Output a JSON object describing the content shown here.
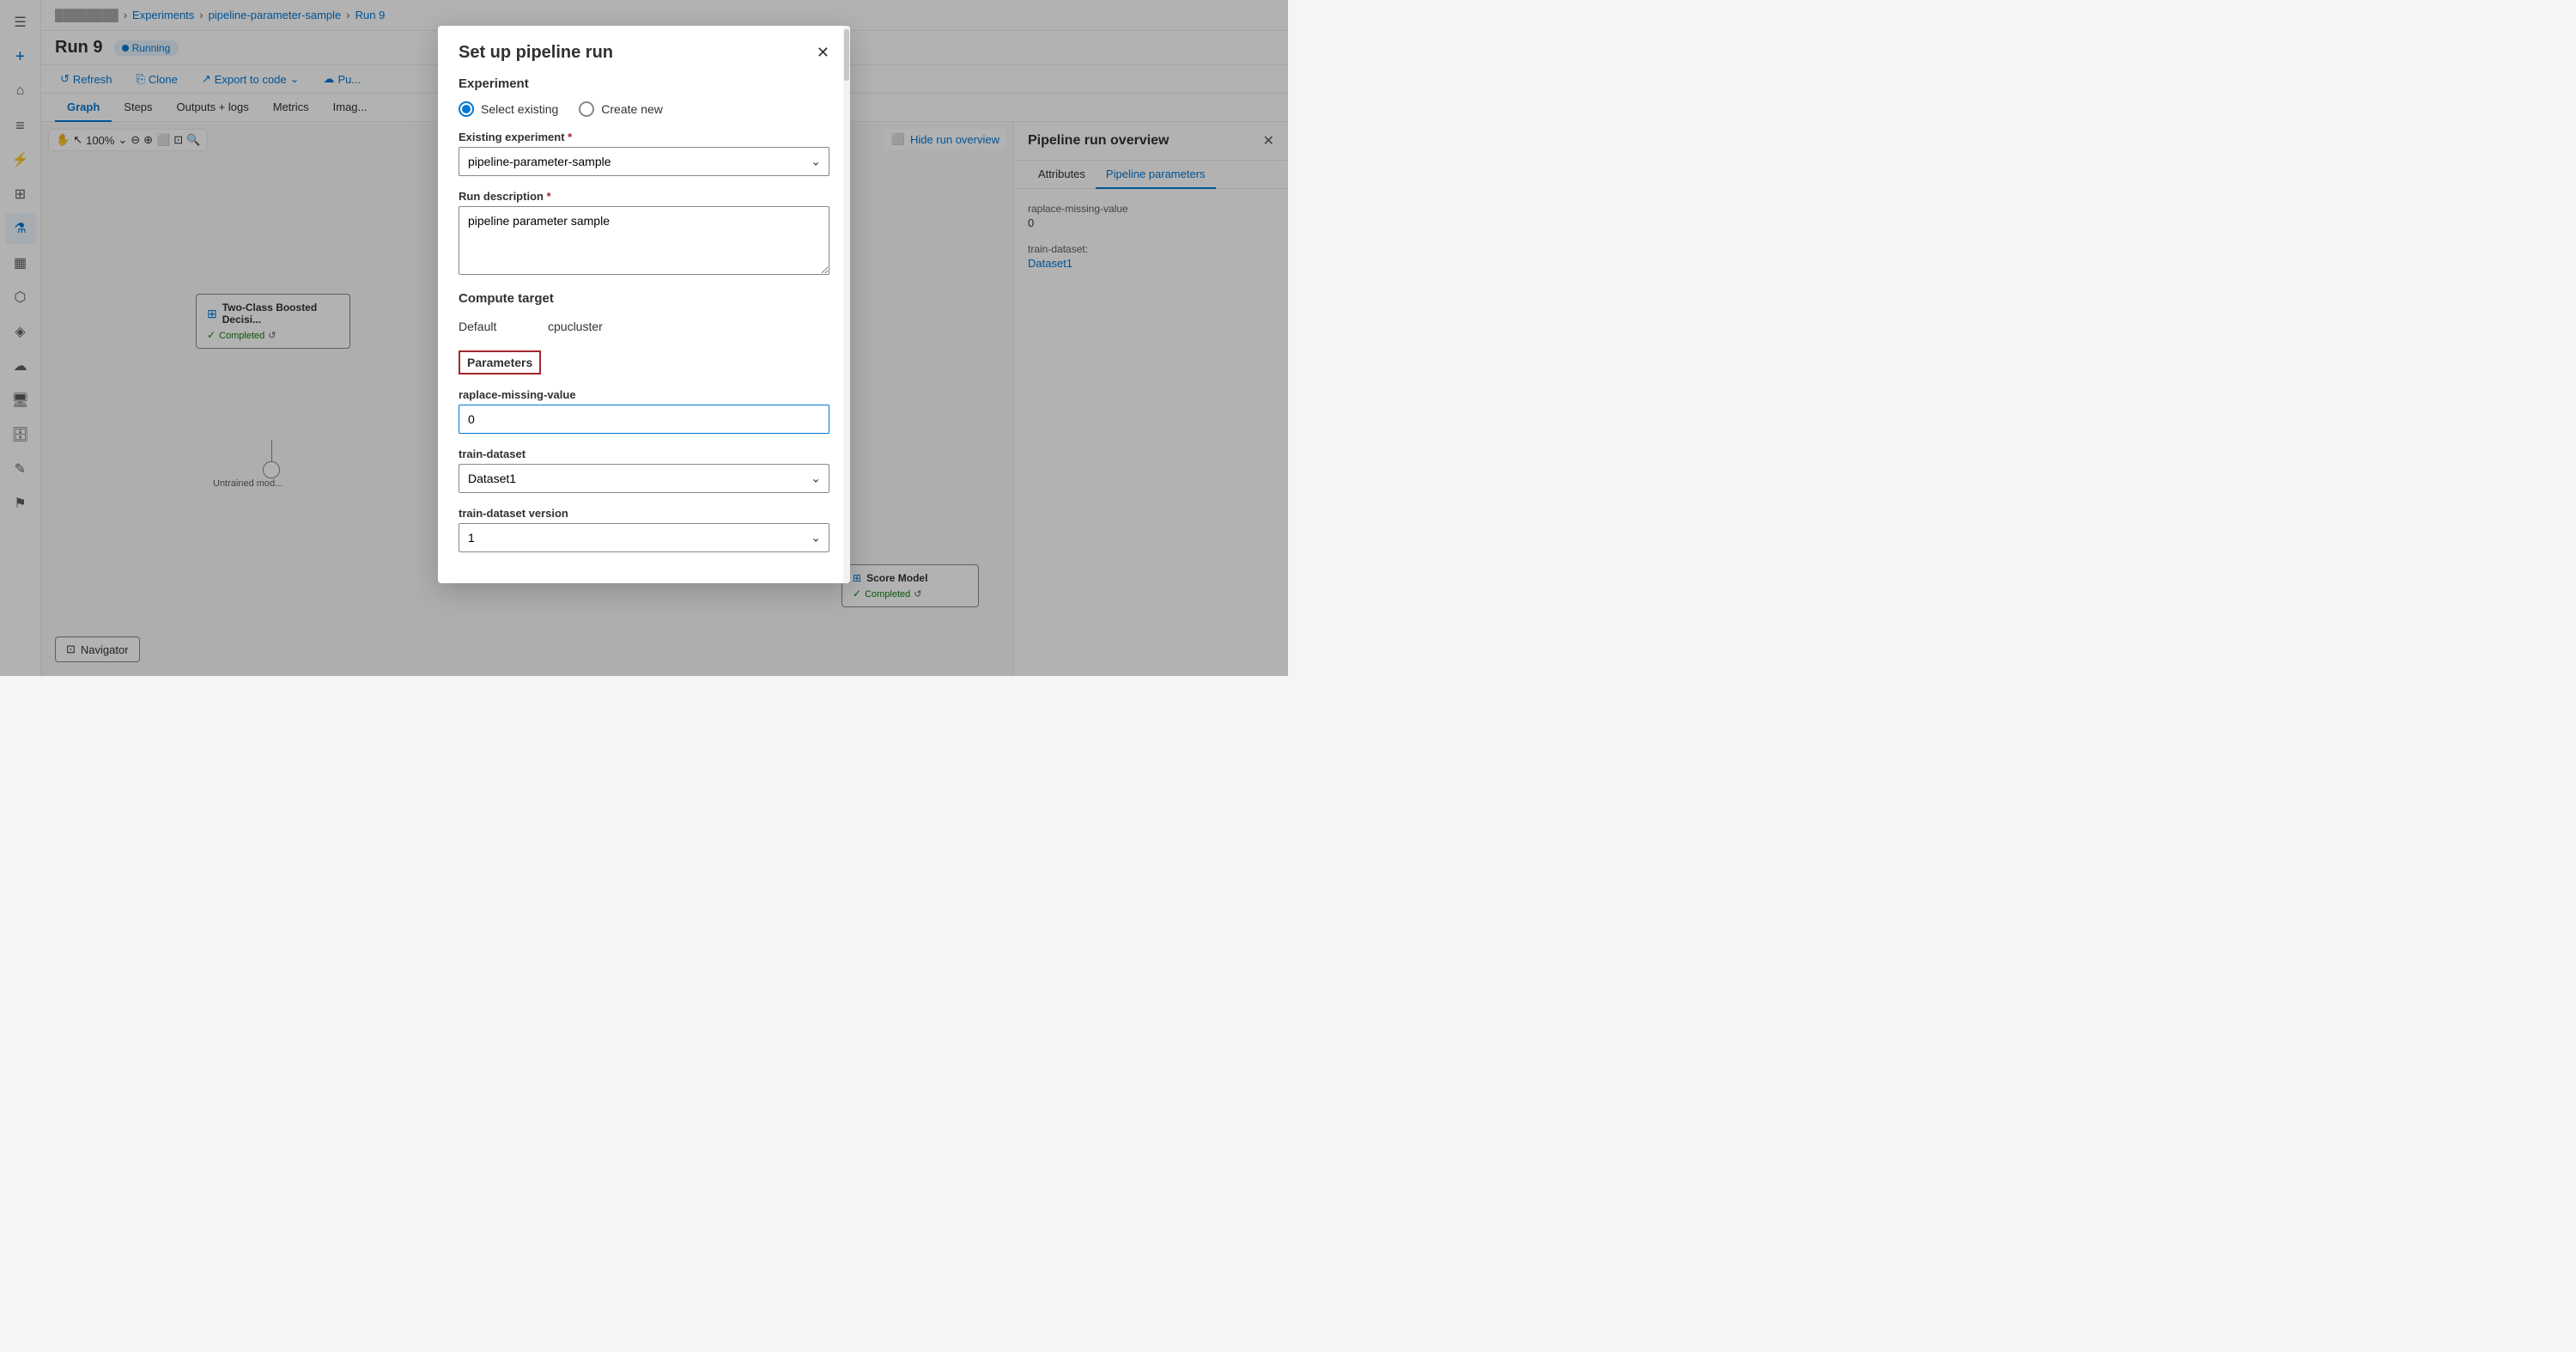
{
  "sidebar": {
    "icons": [
      {
        "name": "menu-icon",
        "symbol": "☰",
        "active": false
      },
      {
        "name": "plus-icon",
        "symbol": "+",
        "active": false
      },
      {
        "name": "home-icon",
        "symbol": "⌂",
        "active": false
      },
      {
        "name": "list-icon",
        "symbol": "≡",
        "active": false
      },
      {
        "name": "lightning-icon",
        "symbol": "⚡",
        "active": false
      },
      {
        "name": "modules-icon",
        "symbol": "⊞",
        "active": false
      },
      {
        "name": "flask-icon",
        "symbol": "⚗",
        "active": true
      },
      {
        "name": "grid-icon",
        "symbol": "▦",
        "active": false
      },
      {
        "name": "nodes-icon",
        "symbol": "⬡",
        "active": false
      },
      {
        "name": "cube-icon",
        "symbol": "◈",
        "active": false
      },
      {
        "name": "cloud-icon",
        "symbol": "☁",
        "active": false
      },
      {
        "name": "computer-icon",
        "symbol": "🖥",
        "active": false
      },
      {
        "name": "database-icon",
        "symbol": "🗄",
        "active": false
      },
      {
        "name": "edit-icon",
        "symbol": "✎",
        "active": false
      },
      {
        "name": "tag-icon",
        "symbol": "⚑",
        "active": false
      }
    ]
  },
  "breadcrumb": {
    "items": [
      "workspace-name",
      "Experiments",
      "pipeline-parameter-sample",
      "Run 9"
    ],
    "separators": [
      "›",
      "›",
      "›"
    ]
  },
  "page": {
    "title": "Run 9",
    "status": "Running"
  },
  "toolbar": {
    "refresh_label": "Refresh",
    "clone_label": "Clone",
    "export_label": "Export to code",
    "publish_label": "Pu..."
  },
  "tabs": {
    "items": [
      "Graph",
      "Steps",
      "Outputs + logs",
      "Metrics",
      "Imag..."
    ],
    "active": 0
  },
  "zoom_bar": {
    "level": "100%"
  },
  "canvas": {
    "node1": {
      "title": "Two-Class Boosted Decisi...",
      "status": "Completed",
      "port_label": "Untrained mod..."
    },
    "node2": {
      "title": "Score Model",
      "status": "Completed"
    }
  },
  "navigator": {
    "label": "Navigator"
  },
  "hide_overview": {
    "label": "Hide run overview"
  },
  "overview_panel": {
    "title": "Pipeline run overview",
    "tabs": [
      "Attributes",
      "Pipeline parameters"
    ],
    "active_tab": 1,
    "params": {
      "raplace_label": "raplace-missing-value",
      "raplace_value": "0",
      "train_dataset_label": "train-dataset:",
      "train_dataset_value": "Dataset1"
    }
  },
  "modal": {
    "title": "Set up pipeline run",
    "experiment_section": "Experiment",
    "radio_select": "Select existing",
    "radio_create": "Create new",
    "existing_experiment_label": "Existing experiment",
    "existing_experiment_value": "pipeline-parameter-sample",
    "run_description_label": "Run description",
    "run_description_value": "pipeline parameter sample",
    "compute_target_section": "Compute target",
    "compute_default_label": "Default",
    "compute_default_value": "cpucluster",
    "parameters_label": "Parameters",
    "raplace_param_label": "raplace-missing-value",
    "raplace_param_value": "0",
    "train_dataset_label": "train-dataset",
    "train_dataset_value": "Dataset1",
    "train_dataset_version_label": "train-dataset version",
    "train_dataset_version_value": "1"
  }
}
